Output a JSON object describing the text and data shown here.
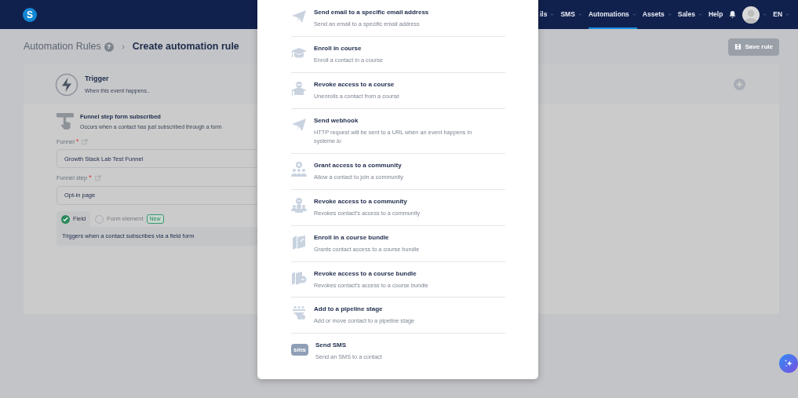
{
  "navbar": {
    "logo": "S",
    "items": [
      {
        "label": "ils",
        "dropdown": true,
        "selected": false
      },
      {
        "label": "SMS",
        "dropdown": true,
        "selected": false
      },
      {
        "label": "Automations",
        "dropdown": true,
        "selected": true
      },
      {
        "label": "Assets",
        "dropdown": true,
        "selected": false
      },
      {
        "label": "Sales",
        "dropdown": true,
        "selected": false
      },
      {
        "label": "Help",
        "dropdown": false,
        "selected": false
      }
    ],
    "language": "EN"
  },
  "breadcrumb": {
    "parent": "Automation Rules",
    "help": "?",
    "current": "Create automation rule"
  },
  "save_button": {
    "label": "Save rule",
    "disabled": true
  },
  "trigger": {
    "title": "Trigger",
    "subtitle": "When this event happens..",
    "event": {
      "title": "Funnel step form subscribed",
      "description": "Occurs when a contact has just subscribed through a form"
    },
    "fields": [
      {
        "label": "Funnel",
        "required_mark": "*",
        "value": "Growth Stack Lab Test Funnel"
      },
      {
        "label": "Funnel step",
        "required_mark": "*",
        "value": "Opt-in page"
      }
    ],
    "options": [
      {
        "label": "Field",
        "selected": true
      },
      {
        "label": "Form element",
        "selected": false,
        "badge": "New"
      }
    ],
    "option_description": "Triggers when a contact subscribes via a field form"
  },
  "actions_modal": {
    "items": [
      {
        "kind": "plane",
        "title": "Send email to a specific email address",
        "description": "Send an email to a specific email address"
      },
      {
        "kind": "cap",
        "title": "Enroll in course",
        "description": "Enroll a contact in a course"
      },
      {
        "kind": "cap-minus",
        "title": "Revoke access to a course",
        "description": "Unenrolls a contact from a course"
      },
      {
        "kind": "plane",
        "title": "Send webhook",
        "description": "HTTP request will be sent to a URL when an event happens in systeme.io"
      },
      {
        "kind": "group-plus",
        "title": "Grant access to a community",
        "description": "Allow a contact to join a community"
      },
      {
        "kind": "group-minus",
        "title": "Revoke access to a community",
        "description": "Revokes contact's access to a community"
      },
      {
        "kind": "books",
        "title": "Enroll in a course bundle",
        "description": "Grants contact access to a course bundle"
      },
      {
        "kind": "books-minus",
        "title": "Revoke access to a course bundle",
        "description": "Revokes contact's access to a course bundle"
      },
      {
        "kind": "pipeline",
        "title": "Add to a pipeline stage",
        "description": "Add or move contact to a pipeline stage"
      },
      {
        "kind": "sms",
        "icon_text": "sms",
        "title": "Send SMS",
        "description": "Send an SMS to a contact"
      }
    ]
  }
}
